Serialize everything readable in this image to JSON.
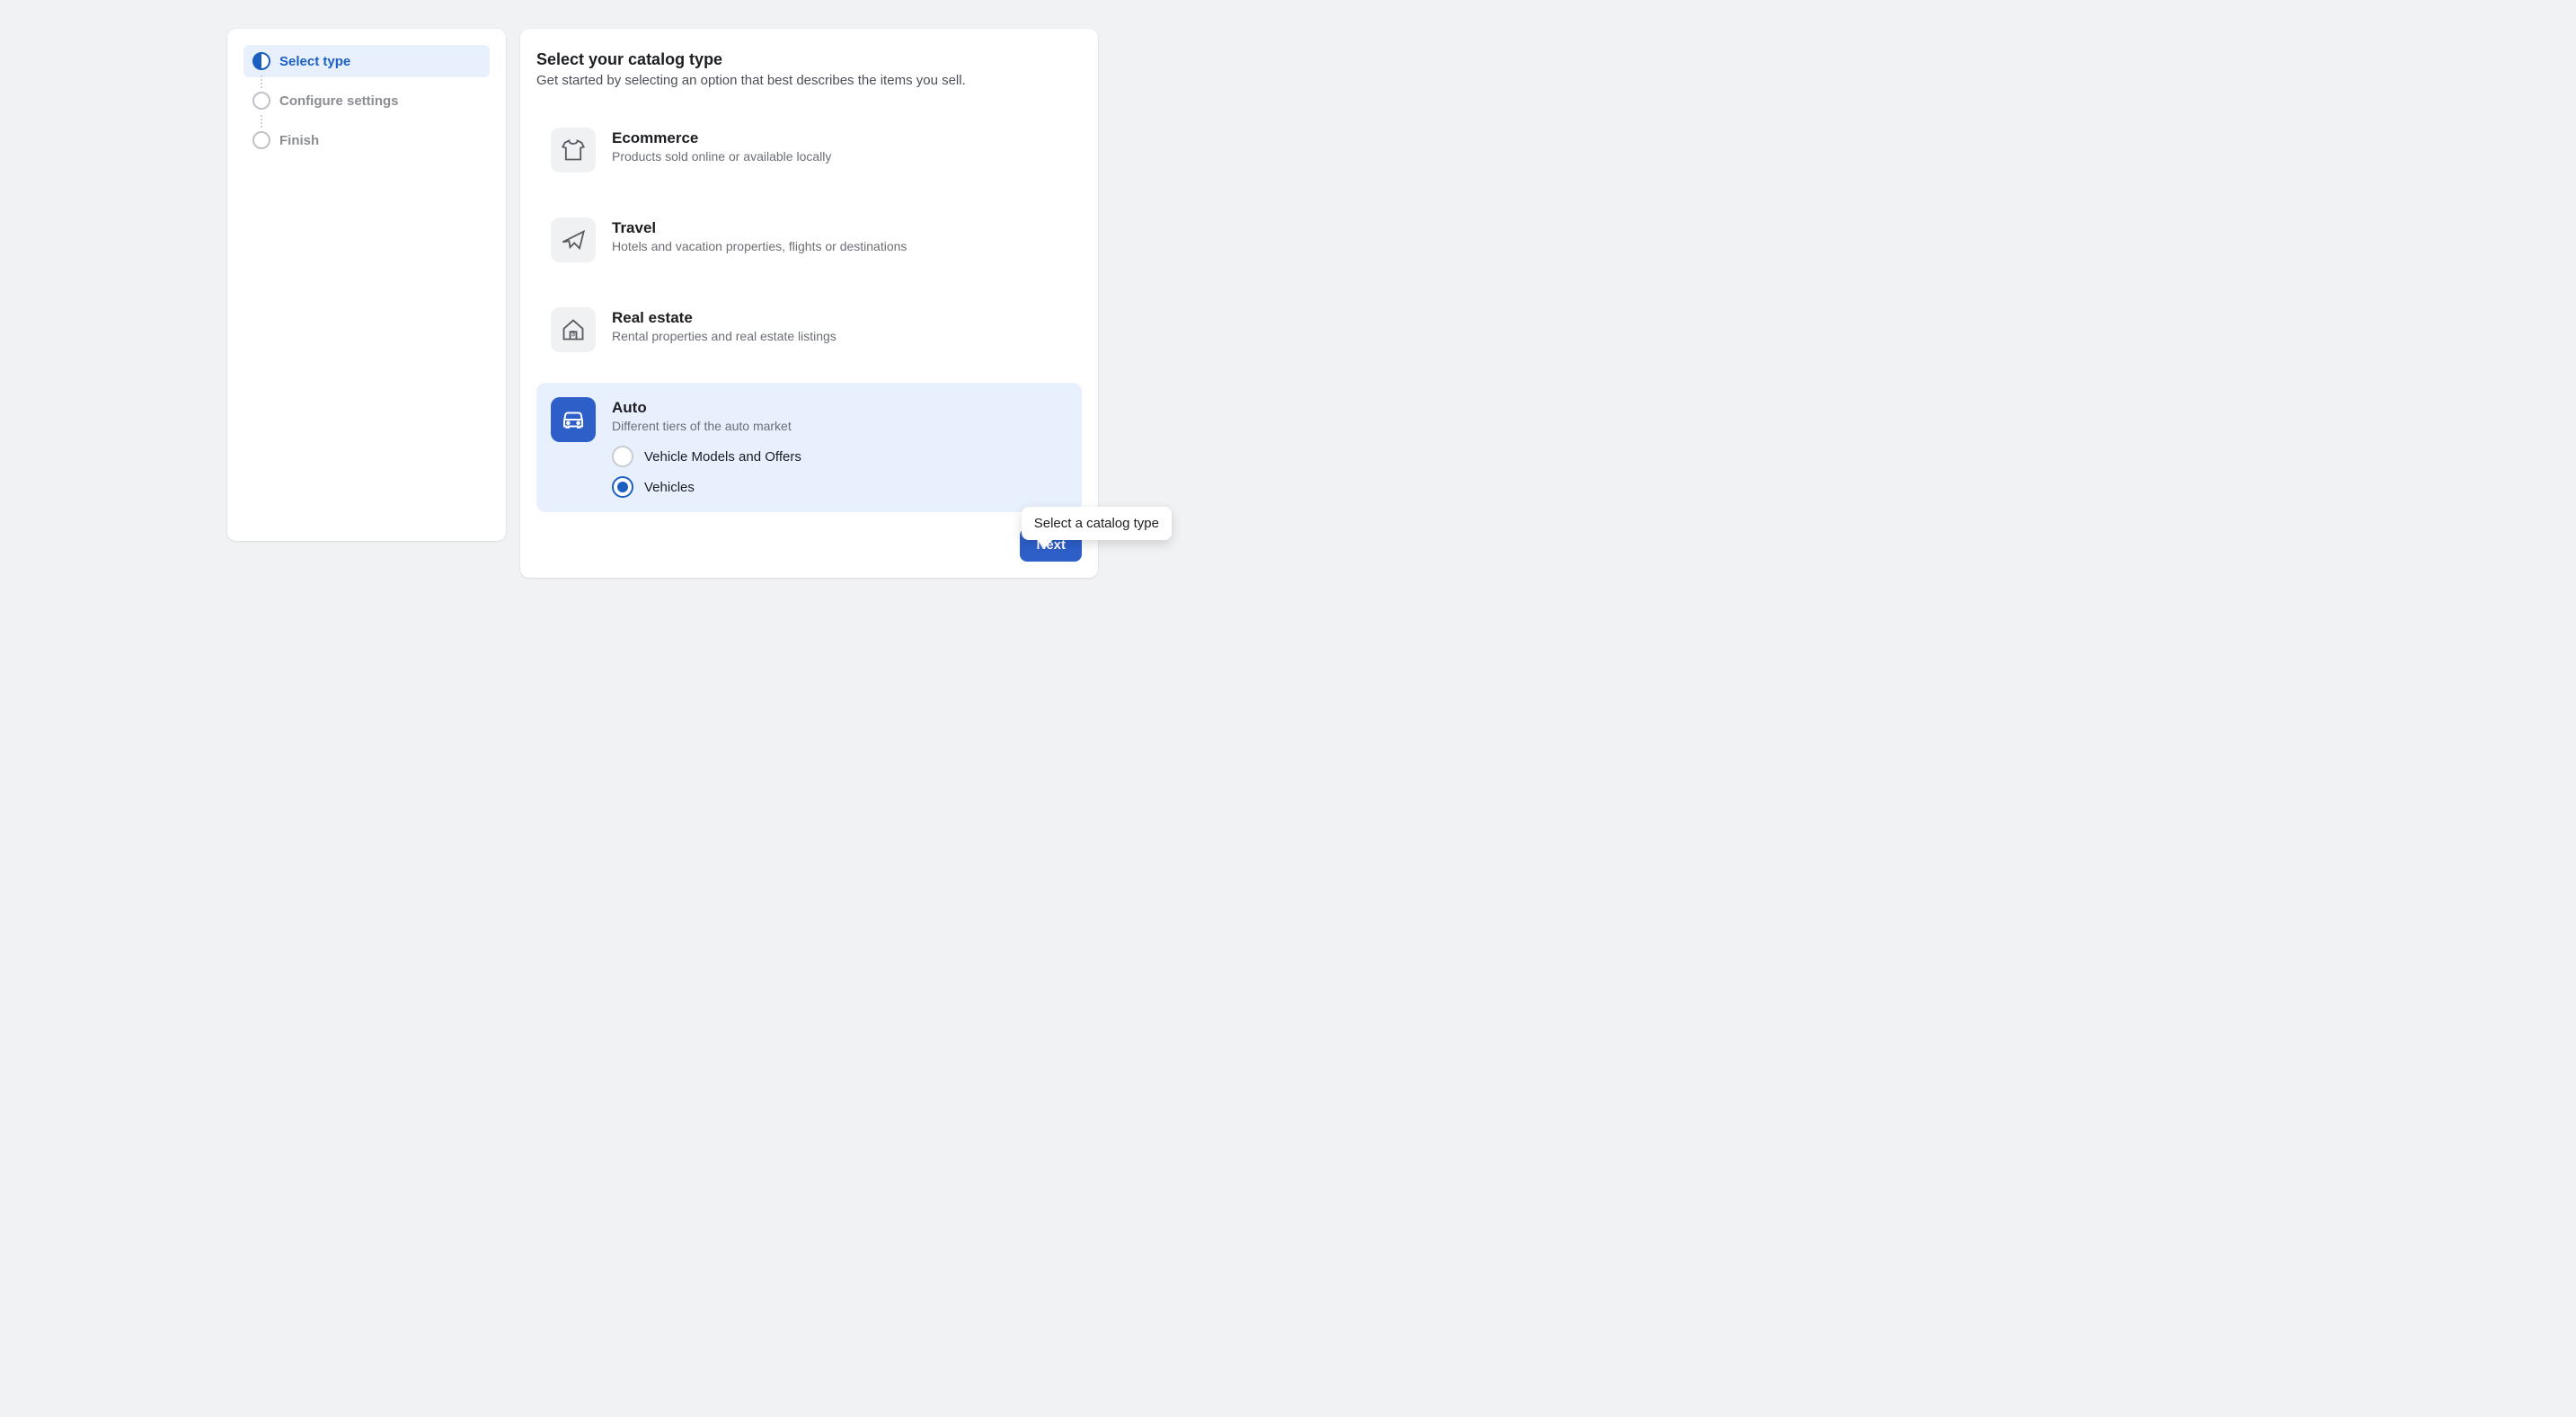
{
  "steps": {
    "0": {
      "label": "Select type"
    },
    "1": {
      "label": "Configure settings"
    },
    "2": {
      "label": "Finish"
    }
  },
  "main": {
    "title": "Select your catalog type",
    "subtitle": "Get started by selecting an option that best describes the items you sell."
  },
  "options": {
    "ecommerce": {
      "title": "Ecommerce",
      "desc": "Products sold online or available locally"
    },
    "travel": {
      "title": "Travel",
      "desc": "Hotels and vacation properties, flights or destinations"
    },
    "real_estate": {
      "title": "Real estate",
      "desc": "Rental properties and real estate listings"
    },
    "auto": {
      "title": "Auto",
      "desc": "Different tiers of the auto market",
      "sub": {
        "0": "Vehicle Models and Offers",
        "1": "Vehicles"
      }
    }
  },
  "tooltip": "Select a catalog type",
  "buttons": {
    "next": "Next"
  }
}
